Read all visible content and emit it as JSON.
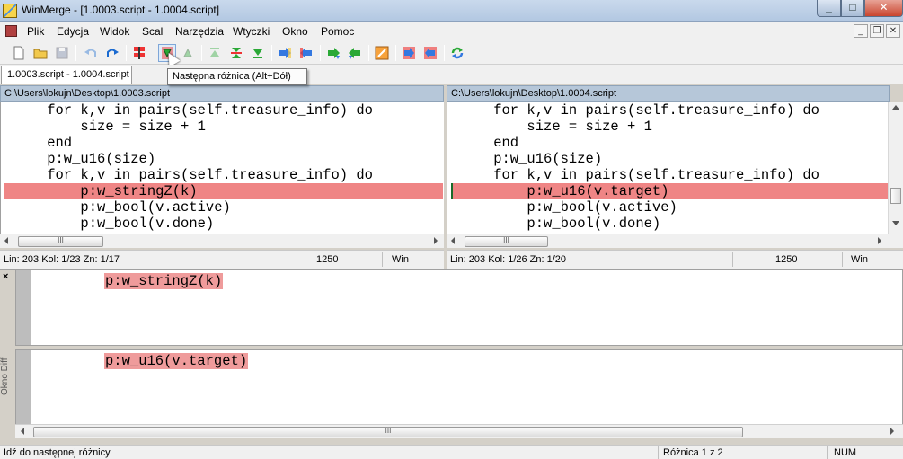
{
  "window": {
    "title": "WinMerge - [1.0003.script - 1.0004.script]"
  },
  "menu": [
    "Plik",
    "Edycja",
    "Widok",
    "Scal",
    "Narzędzia",
    "Wtyczki",
    "Okno",
    "Pomoc"
  ],
  "tab": {
    "label": "1.0003.script - 1.0004.script"
  },
  "tooltip": "Następna różnica (Alt+Dół)",
  "left": {
    "path": "C:\\Users\\lokujn\\Desktop\\1.0003.script",
    "lines": [
      "    for k,v in pairs(self.treasure_info) do",
      "        size = size + 1",
      "    end",
      "    p:w_u16(size)",
      "    for k,v in pairs(self.treasure_info) do",
      "        p:w_stringZ(k)",
      "        p:w_bool(v.active)",
      "        p:w_bool(v.done)"
    ],
    "status": {
      "pos": "Lin: 203  Kol: 1/23  Zn: 1/17",
      "codepage": "1250",
      "eol": "Win"
    }
  },
  "right": {
    "path": "C:\\Users\\lokujn\\Desktop\\1.0004.script",
    "lines": [
      "    for k,v in pairs(self.treasure_info) do",
      "        size = size + 1",
      "    end",
      "    p:w_u16(size)",
      "    for k,v in pairs(self.treasure_info) do",
      "        p:w_u16(v.target)",
      "        p:w_bool(v.active)",
      "        p:w_bool(v.done)"
    ],
    "status": {
      "pos": "Lin: 203  Kol: 1/26  Zn: 1/20",
      "codepage": "1250",
      "eol": "Win"
    }
  },
  "diff_window": {
    "caption": "Okno Diff",
    "top_text": "p:w_stringZ(k)",
    "bottom_text": "p:w_u16(v.target)"
  },
  "statusbar": {
    "hint": "Idź do następnej różnicy",
    "diff_count": "Różnica 1 z 2",
    "num": "NUM"
  },
  "colors": {
    "diff_bg": "#ef8585",
    "pathbar_bg": "#b6c7d9"
  }
}
